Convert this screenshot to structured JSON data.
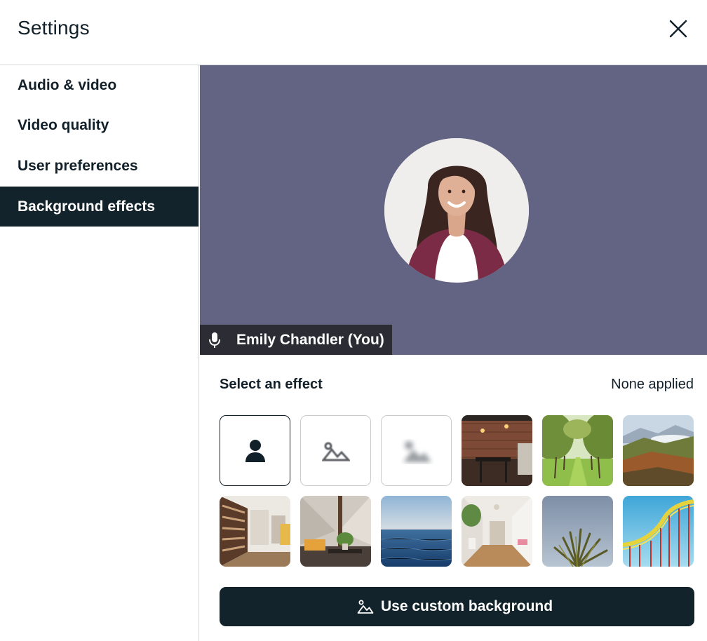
{
  "header": {
    "title": "Settings",
    "close_icon": "close-icon"
  },
  "sidebar": {
    "items": [
      {
        "label": "Audio & video",
        "active": false
      },
      {
        "label": "Video quality",
        "active": false
      },
      {
        "label": "User preferences",
        "active": false
      },
      {
        "label": "Background effects",
        "active": true
      }
    ]
  },
  "preview": {
    "participant_name": "Emily Chandler (You)",
    "mic_icon": "microphone-icon",
    "background_color": "#636383"
  },
  "effects": {
    "label": "Select an effect",
    "status": "None applied",
    "options": [
      {
        "name": "none",
        "icon": "person-icon",
        "selected": true
      },
      {
        "name": "blur",
        "icon": "mountains-icon"
      },
      {
        "name": "strong-blur",
        "icon": "blurred-mountains-icon"
      },
      {
        "name": "brick-cafe"
      },
      {
        "name": "tree-alley"
      },
      {
        "name": "mountain-valley"
      },
      {
        "name": "library"
      },
      {
        "name": "living-room"
      },
      {
        "name": "ocean"
      },
      {
        "name": "white-hallway"
      },
      {
        "name": "palm-sky"
      },
      {
        "name": "roller-coaster"
      }
    ],
    "custom_button_label": "Use custom background",
    "custom_button_icon": "mountains-icon"
  },
  "colors": {
    "accent_dark": "#13232b",
    "border": "#d6d9dc"
  }
}
